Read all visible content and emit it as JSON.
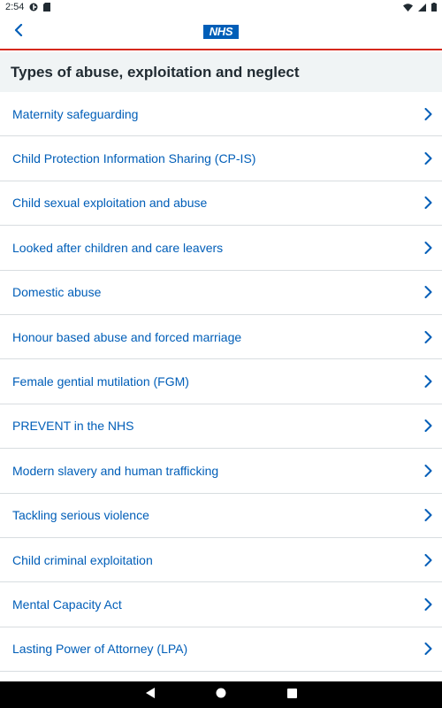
{
  "status_bar": {
    "time": "2:54",
    "icons": [
      "app-notification-icon",
      "sim-card-icon",
      "wifi-icon",
      "cellular-signal-icon",
      "battery-icon"
    ]
  },
  "app_bar": {
    "logo_text": "NHS",
    "back_icon": "chevron-left-icon",
    "accent_color": "#d5281b",
    "brand_color": "#005eb8"
  },
  "page": {
    "title": "Types of abuse, exploitation and neglect"
  },
  "list": {
    "chevron_icon": "chevron-right-icon",
    "items": [
      {
        "label": "Maternity safeguarding"
      },
      {
        "label": "Child Protection Information Sharing (CP-IS)"
      },
      {
        "label": "Child sexual exploitation and abuse"
      },
      {
        "label": "Looked after children and care leavers"
      },
      {
        "label": "Domestic abuse"
      },
      {
        "label": "Honour based abuse and forced marriage"
      },
      {
        "label": "Female gential mutilation (FGM)"
      },
      {
        "label": "PREVENT in the NHS"
      },
      {
        "label": "Modern slavery and human trafficking"
      },
      {
        "label": "Tackling serious violence"
      },
      {
        "label": "Child criminal exploitation"
      },
      {
        "label": "Mental Capacity Act"
      },
      {
        "label": "Lasting Power of Attorney (LPA)"
      }
    ]
  },
  "nav_bar": {
    "buttons": [
      "back-triangle-icon",
      "home-circle-icon",
      "recents-square-icon"
    ]
  }
}
